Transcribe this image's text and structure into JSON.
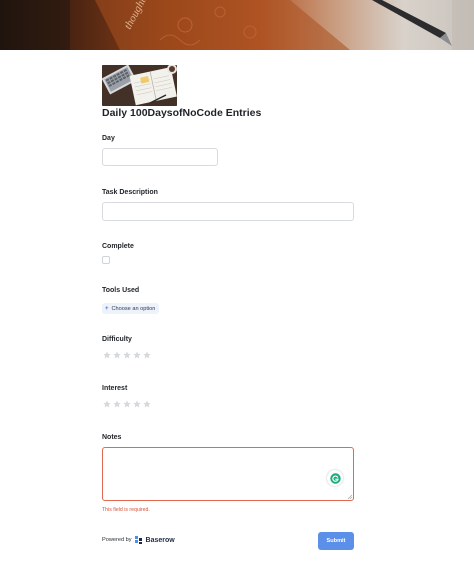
{
  "form": {
    "title": "Daily 100DaysofNoCode Entries",
    "banner_text": "thoughts"
  },
  "fields": {
    "day": {
      "label": "Day",
      "value": ""
    },
    "task_description": {
      "label": "Task Description",
      "value": ""
    },
    "complete": {
      "label": "Complete",
      "checked": false
    },
    "tools_used": {
      "label": "Tools Used",
      "choose_label": "Choose an option"
    },
    "difficulty": {
      "label": "Difficulty",
      "rating": 0,
      "max": 5
    },
    "interest": {
      "label": "Interest",
      "rating": 0,
      "max": 5
    },
    "notes": {
      "label": "Notes",
      "value": "",
      "error": "This field is required."
    }
  },
  "footer": {
    "powered_by": "Powered by",
    "brand": "Baserow",
    "submit_label": "Submit"
  },
  "colors": {
    "accent": "#5b8fe8",
    "error": "#d9533b",
    "star_empty": "#d5d8dc"
  },
  "icons": {
    "banner": "notebook-photo",
    "logo": "laptop-notebook-photo",
    "plus": "plus-icon",
    "star": "star-icon",
    "brand": "baserow-logo-icon",
    "grammar": "grammar-assistant-icon"
  }
}
